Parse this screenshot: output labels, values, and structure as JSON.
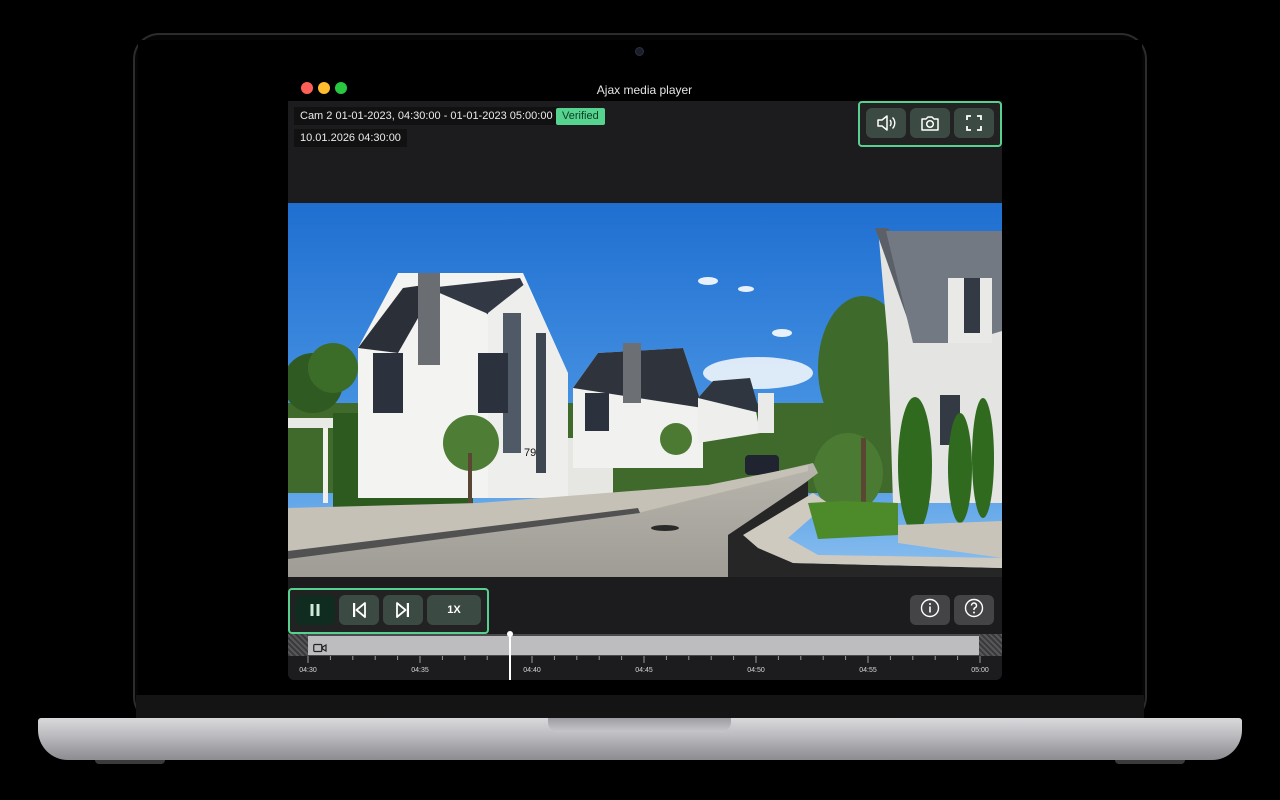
{
  "window": {
    "title": "Ajax media player",
    "traffic_lights": [
      "#ff5f57",
      "#febc2e",
      "#28c840"
    ]
  },
  "overlay": {
    "caption": "Cam 2 01-01-2023, 04:30:00 - 01-01-2023 05:00:00",
    "badge": "Verified",
    "timestamp": "10.01.2026 04:30:00"
  },
  "top_controls": [
    {
      "name": "volume-button",
      "icon": "speaker-icon"
    },
    {
      "name": "snapshot-button",
      "icon": "camera-icon"
    },
    {
      "name": "fullscreen-button",
      "icon": "expand-icon"
    }
  ],
  "playback": {
    "pause_icon": "pause-icon",
    "prev_icon": "skip-back-icon",
    "next_icon": "skip-forward-icon",
    "speed": "1X"
  },
  "right_controls": [
    {
      "name": "info-button",
      "icon": "info-icon"
    },
    {
      "name": "help-button",
      "icon": "help-icon"
    }
  ],
  "house_number": "79",
  "timeline": {
    "labels": [
      "04:30",
      "04:35",
      "04:40",
      "04:45",
      "04:50",
      "04:55",
      "05:00"
    ],
    "playhead_fraction": 0.3,
    "accent": "#58d08f"
  }
}
